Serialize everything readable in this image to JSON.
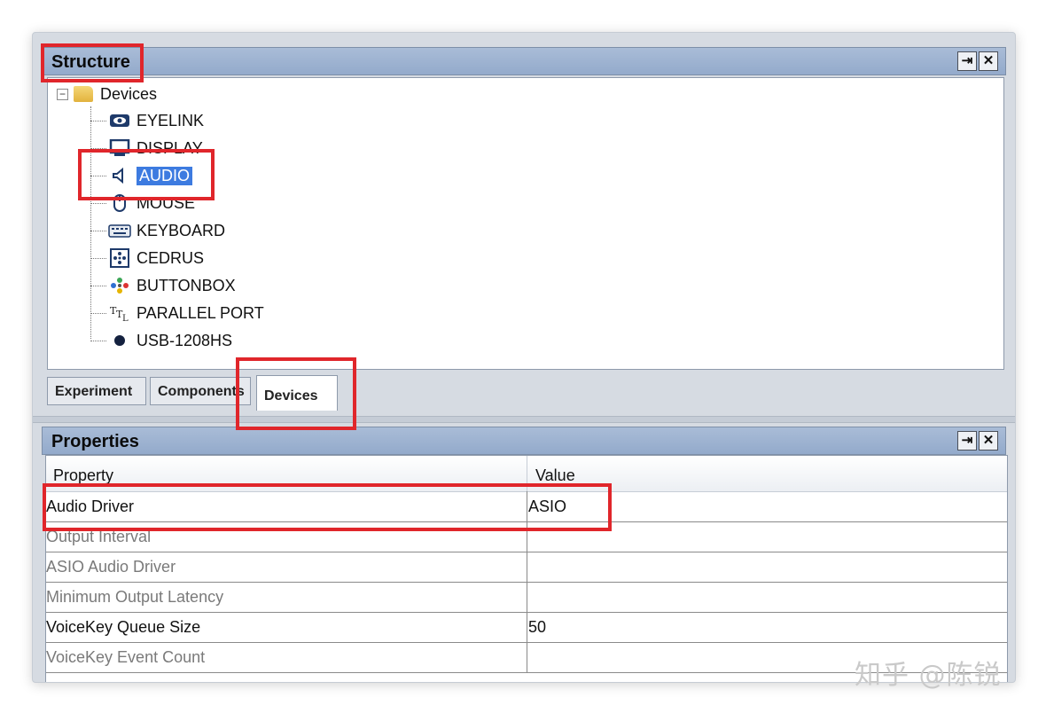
{
  "structure_panel": {
    "title": "Structure",
    "tree": {
      "root_label": "Devices",
      "root_expander": "−",
      "items": [
        {
          "label": "EYELINK",
          "icon": "eye-icon"
        },
        {
          "label": "DISPLAY",
          "icon": "monitor-icon"
        },
        {
          "label": "AUDIO",
          "icon": "speaker-icon",
          "selected": true
        },
        {
          "label": "MOUSE",
          "icon": "mouse-icon"
        },
        {
          "label": "KEYBOARD",
          "icon": "keyboard-icon"
        },
        {
          "label": "CEDRUS",
          "icon": "cedrus-icon"
        },
        {
          "label": "BUTTONBOX",
          "icon": "buttonbox-icon"
        },
        {
          "label": "PARALLEL PORT",
          "icon": "ttl-icon"
        },
        {
          "label": "USB-1208HS",
          "icon": "dot-icon"
        }
      ]
    },
    "tabs": [
      {
        "label": "Experiment"
      },
      {
        "label": "Components"
      },
      {
        "label": "Devices",
        "active": true
      }
    ]
  },
  "properties_panel": {
    "title": "Properties",
    "headers": {
      "property": "Property",
      "value": "Value"
    },
    "rows": [
      {
        "property": "Audio Driver",
        "value": "ASIO",
        "enabled": true
      },
      {
        "property": "Output Interval",
        "value": "",
        "enabled": false
      },
      {
        "property": "ASIO Audio Driver",
        "value": "",
        "enabled": false
      },
      {
        "property": "Minimum Output Latency",
        "value": "",
        "enabled": false
      },
      {
        "property": "VoiceKey Queue Size",
        "value": "50",
        "enabled": true
      },
      {
        "property": "VoiceKey Event Count",
        "value": "",
        "enabled": false
      }
    ]
  },
  "panel_buttons": {
    "pin": "⇥",
    "close": "✕"
  },
  "watermark": "知乎 @陈锐",
  "accent": {
    "selection": "#3d7be0",
    "annotation": "#e0262b",
    "title_bar": "#a9bcd7"
  }
}
